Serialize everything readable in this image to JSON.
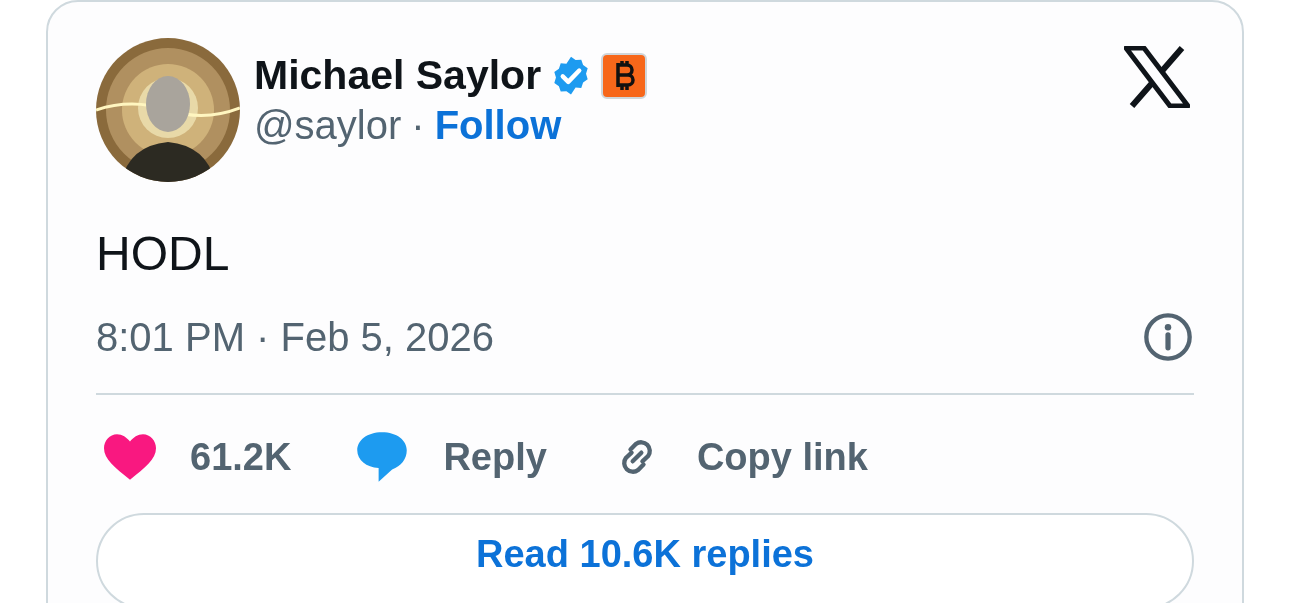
{
  "author": {
    "name": "Michael Saylor",
    "handle": "@saylor",
    "separator": "·",
    "follow": "Follow"
  },
  "text": "HODL",
  "timestamp": "8:01 PM · Feb 5, 2026",
  "actions": [
    {
      "kind": "like",
      "label": "61.2K"
    },
    {
      "kind": "reply",
      "label": "Reply"
    },
    {
      "kind": "copy",
      "label": "Copy link"
    }
  ],
  "replies_button": "Read 10.6K replies"
}
